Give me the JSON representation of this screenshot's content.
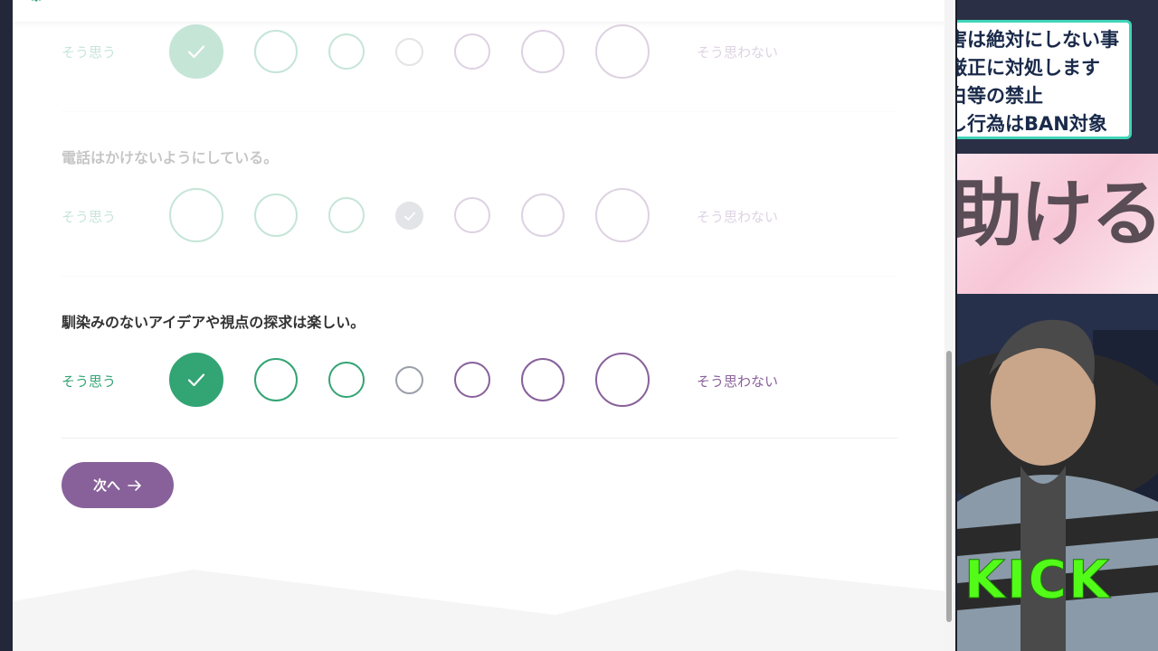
{
  "survey": {
    "questions": [
      {
        "text": "",
        "agree_label": "そう思う",
        "disagree_label": "そう思わない",
        "selected_index": 0,
        "faded": true
      },
      {
        "text": "電話はかけないようにしている。",
        "agree_label": "そう思う",
        "disagree_label": "そう思わない",
        "selected_index": 3,
        "faded": true
      },
      {
        "text": "馴染みのないアイデアや視点の探求は楽しい。",
        "agree_label": "そう思う",
        "disagree_label": "そう思わない",
        "selected_index": 0,
        "faded": false
      }
    ],
    "next_button_label": "次へ",
    "next_button_arrow": "→"
  },
  "overlay": {
    "rules_lines": [
      "害は絶対にしない事",
      "厳正に対処します",
      "白等の禁止",
      "し行為はBAN対象"
    ],
    "promo_text": "助ける",
    "kick_logo_text": "KICK"
  },
  "colors": {
    "agree_green": "#33a474",
    "neutral_gray": "#9b9faa",
    "disagree_purple": "#88619a",
    "overlay_border": "#3fd4b8",
    "kick_green": "#53fc18"
  },
  "icons": {
    "check": "check-icon",
    "arrow": "arrow-right-icon"
  }
}
